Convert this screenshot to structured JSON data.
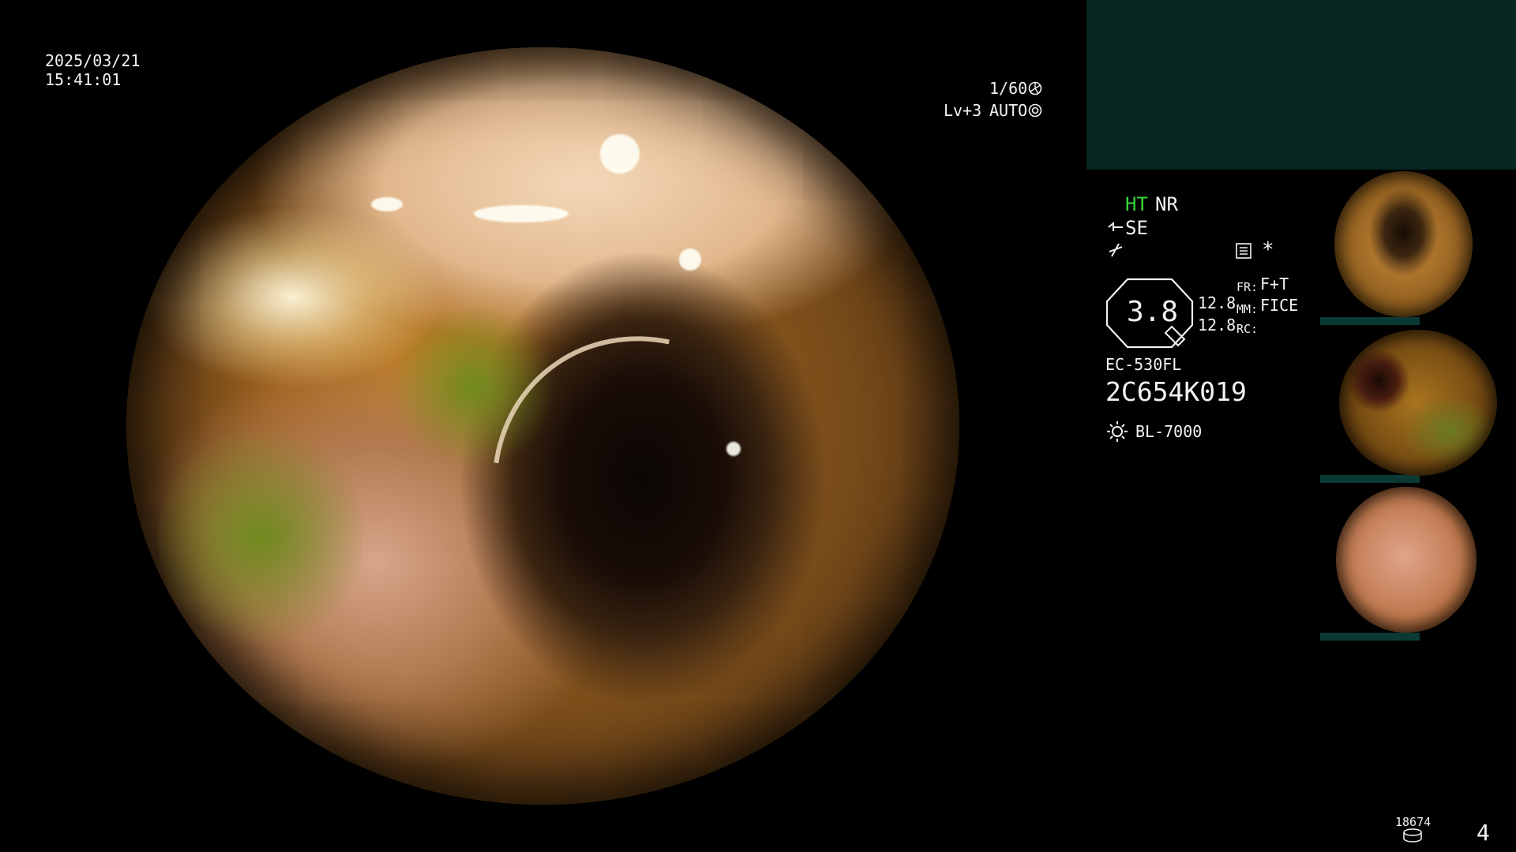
{
  "overlay": {
    "date": "2025/03/21",
    "time": "15:41:01",
    "shutter": "1/60",
    "level": "Lv+3",
    "auto": "AUTO"
  },
  "info_panel": {
    "ht": "HT",
    "nr": "NR",
    "se": "SE",
    "star": "*",
    "zoom": "3.8",
    "val1": "12.8",
    "val2": "12.8",
    "fr_label": "FR:",
    "fr_value": "F+T",
    "mm_label": "MM:",
    "mm_value": "FICE",
    "rc_label": "RC:",
    "scope_model": "EC-530FL",
    "serial": "2C654K019",
    "light_source": "BL-7000"
  },
  "footer": {
    "counter": "18674",
    "page": "4"
  },
  "colors": {
    "panel_bg": "#062622",
    "accent_green": "#35d835",
    "text": "#f2f2f2"
  }
}
